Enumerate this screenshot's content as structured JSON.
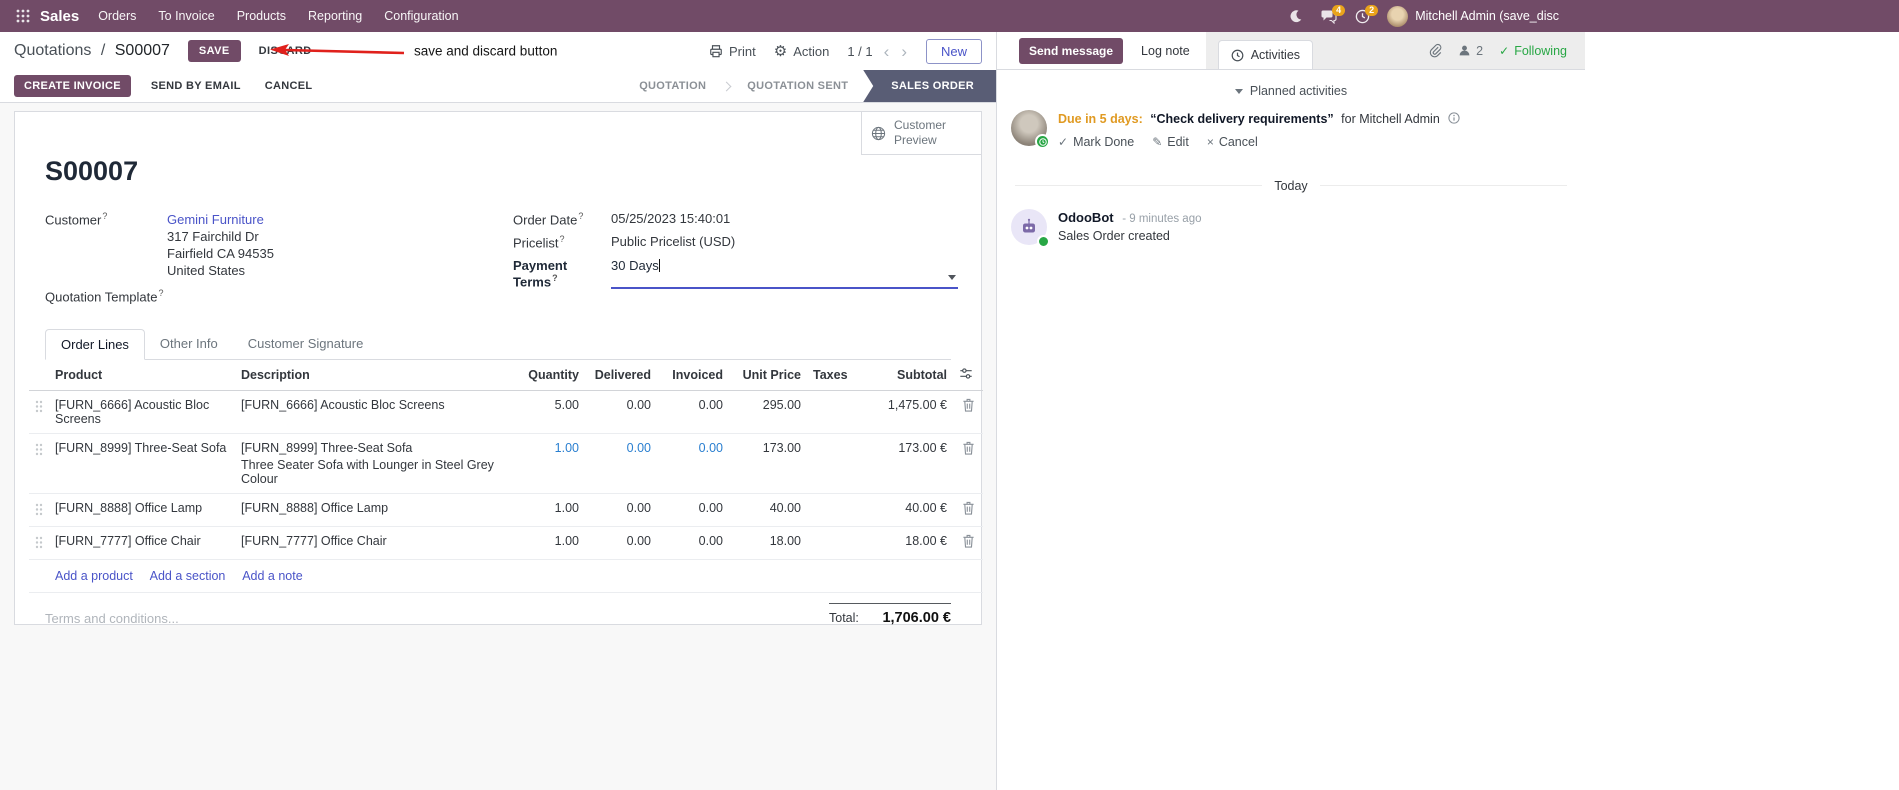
{
  "icons": {
    "gear": "⚙",
    "chevron_left": "‹",
    "chevron_right": "›",
    "check": "✓",
    "pencil": "✎",
    "cross": "×",
    "question": "?"
  },
  "topbar": {
    "app_name": "Sales",
    "menus": [
      "Orders",
      "To Invoice",
      "Products",
      "Reporting",
      "Configuration"
    ],
    "messages_badge": "4",
    "activities_badge": "2",
    "user_name": "Mitchell Admin (save_disc"
  },
  "control_panel": {
    "breadcrumb_parent": "Quotations",
    "breadcrumb_separator": "/",
    "breadcrumb_current": "S00007",
    "save": "SAVE",
    "discard": "DISCARD",
    "annotation": "save and discard button",
    "print": "Print",
    "action": "Action",
    "pager": "1 / 1",
    "new": "New"
  },
  "action_buttons": {
    "create_invoice": "CREATE INVOICE",
    "send_by_email": "SEND BY EMAIL",
    "cancel": "CANCEL"
  },
  "statusbar": {
    "steps": [
      "QUOTATION",
      "QUOTATION SENT",
      "SALES ORDER"
    ],
    "active_step": "SALES ORDER"
  },
  "sheet": {
    "customer_preview": "Customer Preview",
    "title": "S00007",
    "customer_label": "Customer",
    "customer_name": "Gemini Furniture",
    "customer_address": {
      "line1": "317 Fairchild Dr",
      "line2": "Fairfield CA 94535",
      "line3": "United States"
    },
    "quotation_template_label": "Quotation Template",
    "order_date_label": "Order Date",
    "order_date": "05/25/2023 15:40:01",
    "pricelist_label": "Pricelist",
    "pricelist": "Public Pricelist (USD)",
    "payment_terms_label": "Payment Terms",
    "payment_terms": "30 Days"
  },
  "tabs": {
    "order_lines": "Order Lines",
    "other_info": "Other Info",
    "customer_signature": "Customer Signature"
  },
  "order_lines": {
    "headers": {
      "product": "Product",
      "description": "Description",
      "quantity": "Quantity",
      "delivered": "Delivered",
      "invoiced": "Invoiced",
      "unit_price": "Unit Price",
      "taxes": "Taxes",
      "subtotal": "Subtotal"
    },
    "rows": [
      {
        "product": "[FURN_6666] Acoustic Bloc Screens",
        "description": "[FURN_6666] Acoustic Bloc Screens",
        "quantity": "5.00",
        "delivered": "0.00",
        "invoiced": "0.00",
        "unit_price": "295.00",
        "taxes": "",
        "subtotal": "1,475.00 €"
      },
      {
        "product": "[FURN_8999] Three-Seat Sofa",
        "description": "[FURN_8999] Three-Seat Sofa",
        "description_line2": "Three Seater Sofa with Lounger in Steel Grey Colour",
        "quantity": "1.00",
        "delivered": "0.00",
        "invoiced": "0.00",
        "unit_price": "173.00",
        "taxes": "",
        "subtotal": "173.00 €"
      },
      {
        "product": "[FURN_8888] Office Lamp",
        "description": "[FURN_8888] Office Lamp",
        "quantity": "1.00",
        "delivered": "0.00",
        "invoiced": "0.00",
        "unit_price": "40.00",
        "taxes": "",
        "subtotal": "40.00 €"
      },
      {
        "product": "[FURN_7777] Office Chair",
        "description": "[FURN_7777] Office Chair",
        "quantity": "1.00",
        "delivered": "0.00",
        "invoiced": "0.00",
        "unit_price": "18.00",
        "taxes": "",
        "subtotal": "18.00 €"
      }
    ],
    "add_product": "Add a product",
    "add_section": "Add a section",
    "add_note": "Add a note",
    "terms_placeholder": "Terms and conditions...",
    "total_label": "Total:",
    "total_value": "1,706.00 €"
  },
  "chatter": {
    "send_message": "Send message",
    "log_note": "Log note",
    "activities_tab": "Activities",
    "followers_count": "2",
    "following": "Following",
    "planned_header": "Planned activities",
    "activity": {
      "due": "Due in 5 days:",
      "summary": "“Check delivery requirements”",
      "assignee": "for Mitchell Admin",
      "mark_done": "Mark Done",
      "edit": "Edit",
      "cancel": "Cancel"
    },
    "today": "Today",
    "message": {
      "author": "OdooBot",
      "time": "- 9 minutes ago",
      "body": "Sales Order created"
    }
  }
}
